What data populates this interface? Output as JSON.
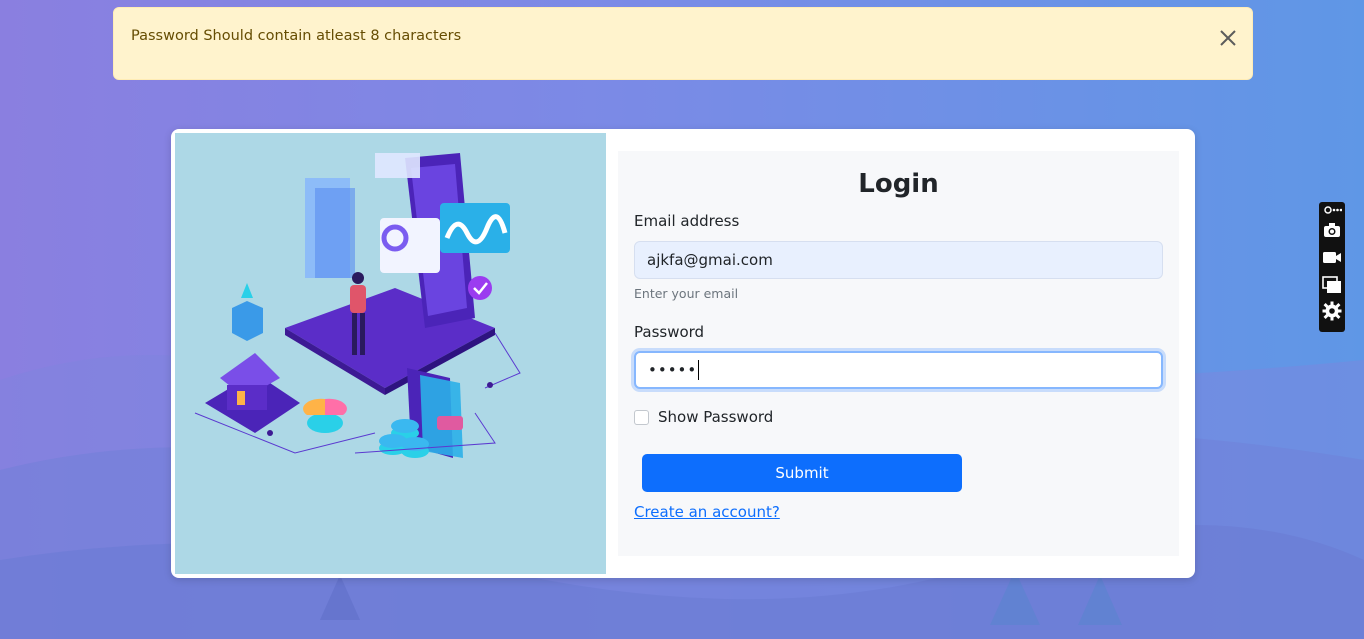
{
  "alert": {
    "message": "Password Should contain atleast 8 characters",
    "close_icon": "close-icon",
    "background": "#fff3cd",
    "text_color": "#664d03"
  },
  "login": {
    "title": "Login",
    "email_label": "Email address",
    "email_value": "ajkfa@gmai.com",
    "email_help": "Enter your email",
    "password_label": "Password",
    "password_value": "•••••",
    "show_password_label": "Show Password",
    "show_password_checked": false,
    "submit_label": "Submit",
    "create_account_link": "Create an account?",
    "accent_color": "#0d6efd"
  },
  "illustration": {
    "background": "#add8e6",
    "icon": "fintech-isometric-illustration"
  },
  "extension_toolbar": {
    "items": [
      "link-icon",
      "camera-icon",
      "video-icon",
      "window-icon",
      "gear-icon"
    ]
  }
}
